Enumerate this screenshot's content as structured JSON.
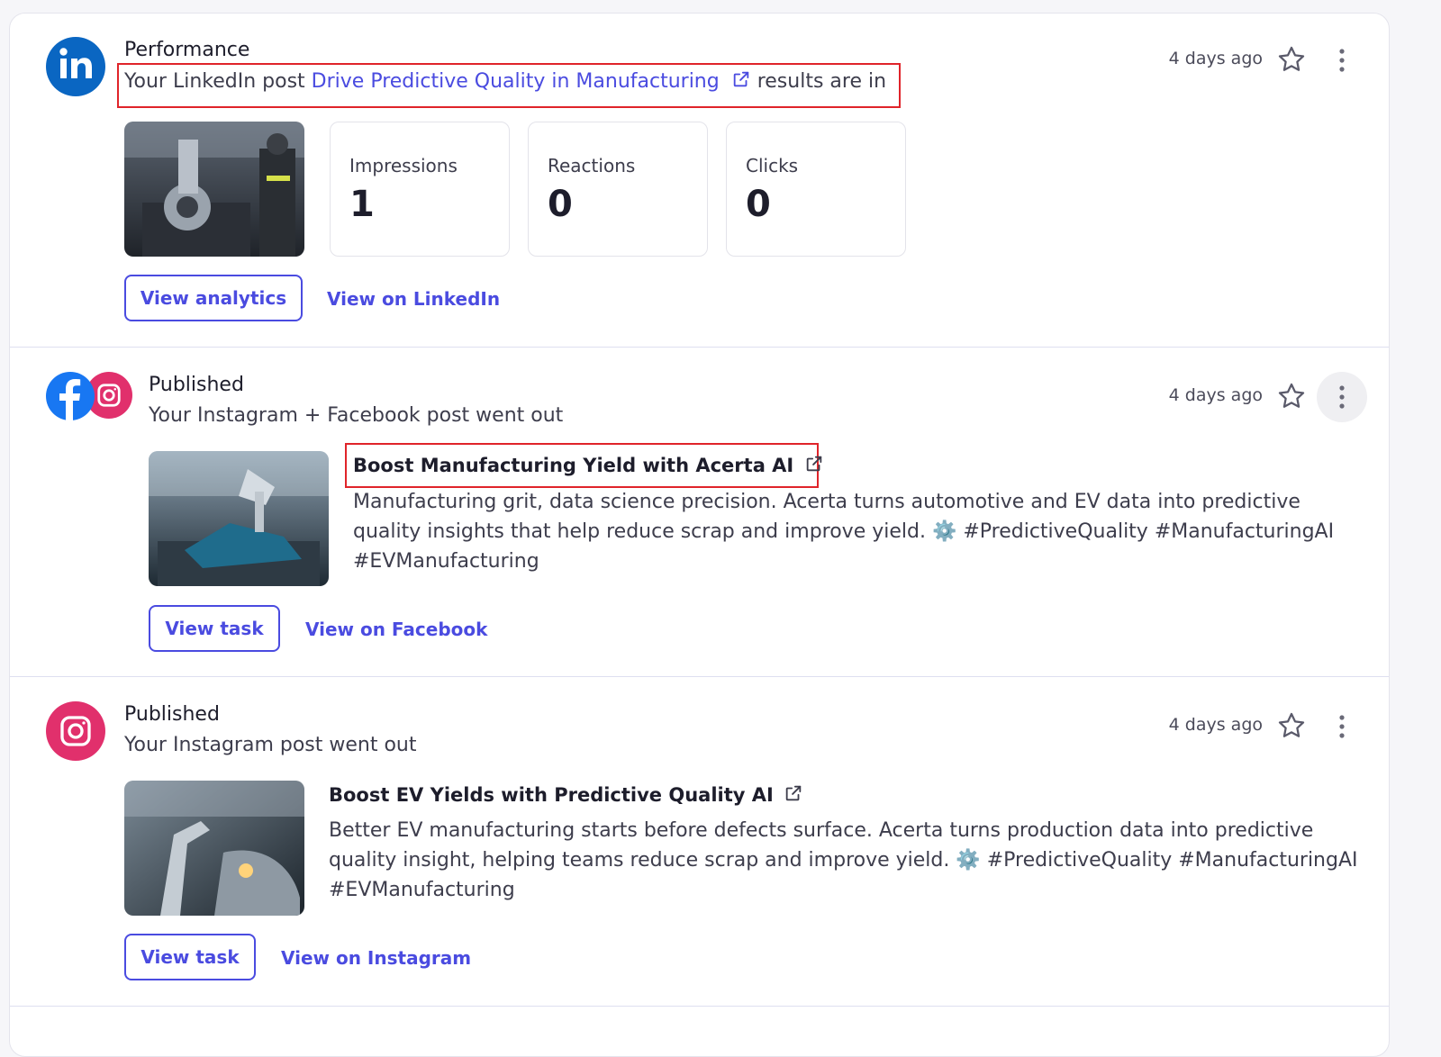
{
  "items": [
    {
      "kicker": "Performance",
      "line_prefix": "Your LinkedIn post ",
      "line_link": "Drive Predictive Quality in Manufacturing",
      "line_suffix": " results are in",
      "time": "4 days ago",
      "stats": [
        {
          "label": "Impressions",
          "value": "1"
        },
        {
          "label": "Reactions",
          "value": "0"
        },
        {
          "label": "Clicks",
          "value": "0"
        }
      ],
      "primary_button": "View analytics",
      "secondary_link": "View on LinkedIn"
    },
    {
      "kicker": "Published",
      "line": "Your Instagram + Facebook post went out",
      "time": "4 days ago",
      "title": "Boost Manufacturing Yield with Acerta AI",
      "body_1": "Manufacturing grit, data science precision. Acerta turns automotive and EV data into predictive",
      "body_2": "quality insights that help reduce scrap and improve yield. ⚙️ #PredictiveQuality #ManufacturingAI",
      "body_3": "#EVManufacturing",
      "primary_button": "View task",
      "secondary_link": "View on Facebook"
    },
    {
      "kicker": "Published",
      "line": "Your Instagram post went out",
      "time": "4 days ago",
      "title": "Boost EV Yields with Predictive Quality AI",
      "body_1": "Better EV manufacturing starts before defects surface. Acerta turns production data into predictive",
      "body_2": "quality insight, helping teams reduce scrap and improve yield. ⚙️ #PredictiveQuality #ManufacturingAI",
      "body_3": "#EVManufacturing",
      "primary_button": "View task",
      "secondary_link": "View on Instagram"
    }
  ],
  "colors": {
    "accent": "#4a4be0",
    "linkedin": "#0a66c2",
    "facebook": "#1877f2",
    "instagram": "#e1306c",
    "highlight": "#e0242a"
  },
  "icons": [
    "linkedin-icon",
    "facebook-icon",
    "instagram-icon",
    "star-icon",
    "kebab-icon",
    "external-link-icon"
  ]
}
